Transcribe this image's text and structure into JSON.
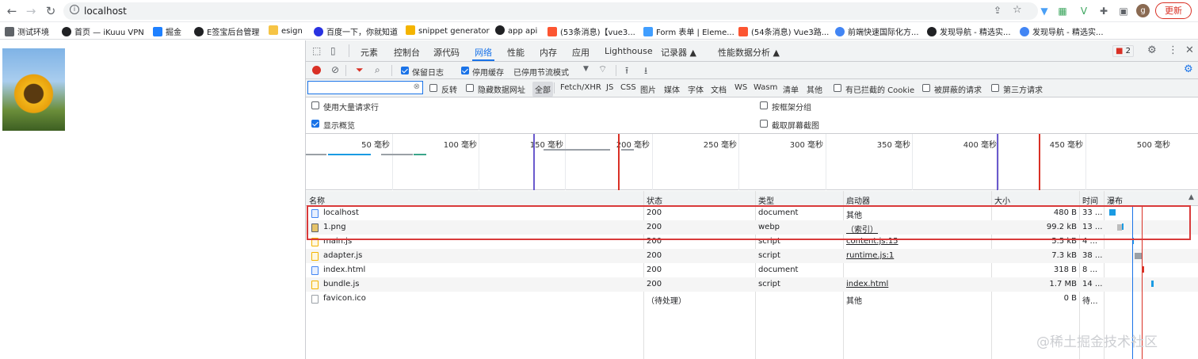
{
  "browser": {
    "url": "localhost",
    "update_label": "更新",
    "profile_initial": "g",
    "bookmarks": [
      {
        "label": "测试环境",
        "color": "#5f6368"
      },
      {
        "label": "首页 — iKuuu VPN",
        "color": "#202124"
      },
      {
        "label": "掘金",
        "color": "#1e80ff"
      },
      {
        "label": "E签宝后台管理",
        "color": "#202124"
      },
      {
        "label": "esign",
        "color": "#f6c445"
      },
      {
        "label": "百度一下，你就知道",
        "color": "#2932e1"
      },
      {
        "label": "snippet generator",
        "color": "#f4b400"
      },
      {
        "label": "app api",
        "color": "#202124"
      },
      {
        "label": "(53条消息)【vue3...",
        "color": "#fc5531"
      },
      {
        "label": "Form 表单 | Eleme...",
        "color": "#409eff"
      },
      {
        "label": "(54条消息) Vue3路...",
        "color": "#fc5531"
      },
      {
        "label": "前端快速国际化方...",
        "color": "#4285f4"
      },
      {
        "label": "发现导航 - 精选实...",
        "color": "#202124"
      },
      {
        "label": "发现导航 - 精选实...",
        "color": "#4285f4"
      }
    ]
  },
  "devtools": {
    "tabs": [
      "元素",
      "控制台",
      "源代码",
      "网络",
      "性能",
      "内存",
      "应用",
      "Lighthouse",
      "记录器 ▲",
      "性能数据分析 ▲"
    ],
    "selected_tab": "网络",
    "issue_count": "2",
    "toolbar1": {
      "preserve_log": "保留日志",
      "disable_cache": "停用缓存",
      "throttling": "已停用节流模式"
    },
    "toolbar2": {
      "filter_placeholder": "",
      "invert": "反转",
      "hide_data_urls": "隐藏数据网址",
      "types": [
        "全部",
        "Fetch/XHR",
        "JS",
        "CSS",
        "图片",
        "媒体",
        "字体",
        "文档",
        "WS",
        "Wasm",
        "清单",
        "其他"
      ],
      "blocked_cookies": "有已拦截的 Cookie",
      "blocked_requests": "被屏蔽的请求",
      "third_party": "第三方请求"
    },
    "settings": {
      "large_rows": "使用大量请求行",
      "group_by_frame": "按框架分组",
      "show_overview": "显示概览",
      "capture_screenshots": "截取屏幕截图"
    },
    "overview_ticks": [
      "50 毫秒",
      "100 毫秒",
      "150 毫秒",
      "200 毫秒",
      "250 毫秒",
      "300 毫秒",
      "350 毫秒",
      "400 毫秒",
      "450 毫秒",
      "500 毫秒"
    ],
    "columns": [
      "名称",
      "状态",
      "类型",
      "启动器",
      "大小",
      "时间",
      "瀑布"
    ],
    "rows": [
      {
        "name": "localhost",
        "status": "200",
        "type": "document",
        "initiator": "其他",
        "initiator_link": false,
        "size": "480 B",
        "time": "33 ...",
        "icon": "doc"
      },
      {
        "name": "1.png",
        "status": "200",
        "type": "webp",
        "initiator": "（索引）",
        "initiator_link": true,
        "size": "99.2 kB",
        "time": "13 ...",
        "icon": "img"
      },
      {
        "name": "main.js",
        "status": "200",
        "type": "script",
        "initiator": "content.js:15",
        "initiator_link": true,
        "size": "5.5 kB",
        "time": "4 ...",
        "icon": "js"
      },
      {
        "name": "adapter.js",
        "status": "200",
        "type": "script",
        "initiator": "runtime.js:1",
        "initiator_link": true,
        "size": "7.3 kB",
        "time": "38 ...",
        "icon": "js"
      },
      {
        "name": "index.html",
        "status": "200",
        "type": "document",
        "initiator": "",
        "initiator_link": false,
        "size": "318 B",
        "time": "8 ...",
        "icon": "doc"
      },
      {
        "name": "bundle.js",
        "status": "200",
        "type": "script",
        "initiator": "index.html",
        "initiator_link": true,
        "size": "1.7 MB",
        "time": "14 ...",
        "icon": "js"
      },
      {
        "name": "favicon.ico",
        "status": "（待处理）",
        "type": "",
        "initiator": "其他",
        "initiator_link": false,
        "size": "0 B",
        "time": "待...",
        "icon": "ico"
      }
    ]
  },
  "watermark": "@稀土掘金技术社区"
}
